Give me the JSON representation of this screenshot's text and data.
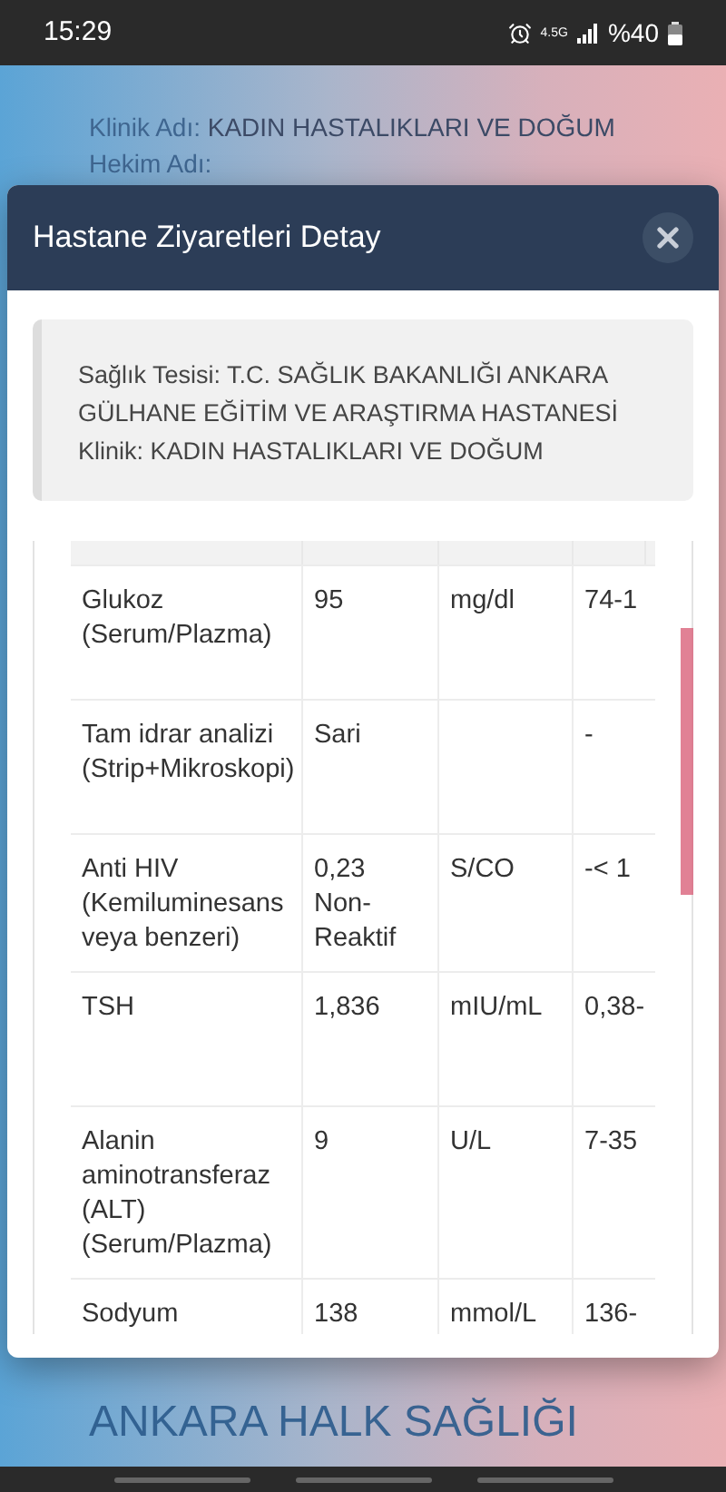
{
  "status_bar": {
    "time": "15:29",
    "network": "4.5G",
    "battery": "%40"
  },
  "background": {
    "fields": [
      {
        "label": "Klinik Adı:",
        "value": "KADIN HASTALIKLARI VE DOĞUM"
      },
      {
        "label": "Hekim Adı:"
      }
    ],
    "heading_bottom": [
      "ANKARA HALK SAĞLIĞI"
    ]
  },
  "dialog": {
    "title": "Hastane Ziyaretleri Detay",
    "info": [
      "Sağlık Tesisi: T.C. SAĞLIK BAKANLIĞI ANKARA GÜLHANE EĞİTİM VE ARAŞTIRMA HASTANESİ",
      "Klinik: KADIN HASTALIKLARI VE DOĞUM"
    ],
    "table": {
      "rows": [
        [
          "Glukoz (Serum/Plazma)",
          "95",
          "mg/dl",
          "74-1"
        ],
        [
          "Tam idrar analizi (Strip+Mikroskopi)",
          "Sari",
          "",
          "-"
        ],
        [
          "Anti HIV (Kemiluminesans veya benzeri)",
          "0,23 Non-Reaktif",
          "S/CO",
          "-< 1"
        ],
        [
          "TSH",
          "1,836",
          "mIU/mL",
          "0,38-"
        ],
        [
          "Alanin aminotransferaz (ALT) (Serum/Plazma)",
          "9",
          "U/L",
          "7-35"
        ],
        [
          "Sodyum",
          "138",
          "mmol/L",
          "136-"
        ]
      ]
    }
  }
}
